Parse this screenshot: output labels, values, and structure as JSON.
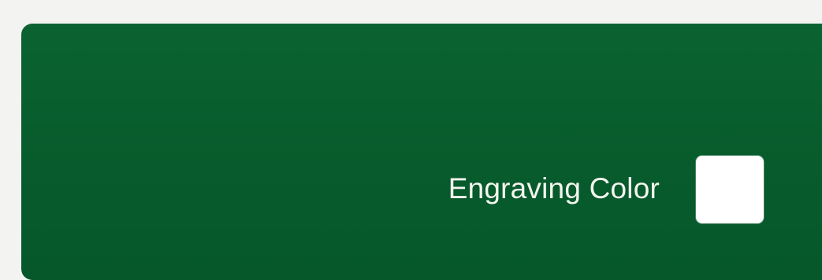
{
  "engraving": {
    "label": "Engraving Color",
    "selected_color": "#ffffff"
  },
  "colors": {
    "panel_background": "#075b2c",
    "label_text": "#f3f5ef"
  }
}
